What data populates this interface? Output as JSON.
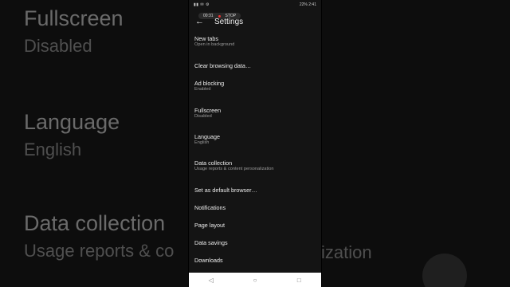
{
  "background": {
    "items": [
      {
        "title": "Fullscreen",
        "subtitle": "Disabled"
      },
      {
        "title": "Language",
        "subtitle": "English"
      },
      {
        "title": "Data collection",
        "subtitle": "Usage reports & co"
      },
      {
        "title": "",
        "subtitle": "ization"
      }
    ]
  },
  "status_bar": {
    "left": "Signal icons",
    "right": "22% 2:41"
  },
  "recording": {
    "time": "00:31",
    "stop_label": "STOP"
  },
  "app_bar": {
    "title": "Settings"
  },
  "settings": [
    {
      "title": "New tabs",
      "subtitle": "Open in background"
    },
    {
      "title": "Clear browsing data…",
      "subtitle": ""
    },
    {
      "title": "Ad blocking",
      "subtitle": "Enabled"
    },
    {
      "title": "Fullscreen",
      "subtitle": "Disabled"
    },
    {
      "title": "Language",
      "subtitle": "English"
    },
    {
      "title": "Data collection",
      "subtitle": "Usage reports & content personalization"
    },
    {
      "title": "Set as default browser…",
      "subtitle": ""
    },
    {
      "title": "Notifications",
      "subtitle": ""
    },
    {
      "title": "Page layout",
      "subtitle": ""
    },
    {
      "title": "Data savings",
      "subtitle": ""
    },
    {
      "title": "Downloads",
      "subtitle": ""
    }
  ],
  "icons": {
    "back": "back-arrow-icon",
    "nav_back": "triangle-back-icon",
    "nav_home": "circle-home-icon",
    "nav_recent": "square-recent-icon"
  }
}
